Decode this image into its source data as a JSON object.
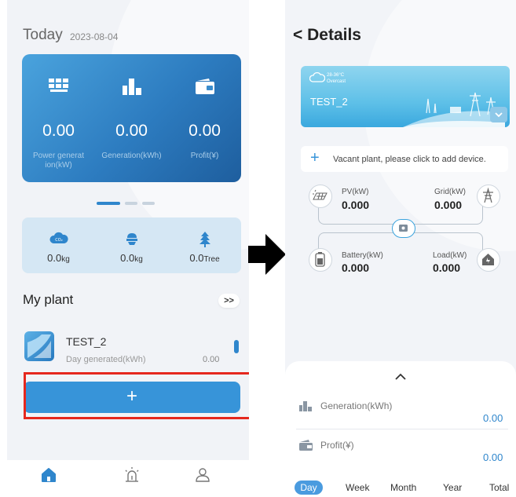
{
  "left": {
    "today_label": "Today",
    "today_date": "2023-08-04",
    "stats": [
      {
        "value": "0.00",
        "label": "Power generat ion(kW)",
        "icon": "solar-panel-icon"
      },
      {
        "value": "0.00",
        "label": "Generation(kWh)",
        "icon": "bar-chart-icon"
      },
      {
        "value": "0.00",
        "label": "Profit(¥)",
        "icon": "wallet-icon"
      }
    ],
    "eco": [
      {
        "value": "0.0",
        "unit": "kg",
        "icon": "co2-cloud-icon",
        "icon_text": "CO₂"
      },
      {
        "value": "0.0",
        "unit": "kg",
        "icon": "coal-icon"
      },
      {
        "value": "0.0",
        "unit": "Tree",
        "icon": "tree-icon"
      }
    ],
    "my_plant": "My plant",
    "more_label": ">>",
    "plant": {
      "name": "TEST_2",
      "day_label": "Day generated(kWh)",
      "day_value": "0.00"
    },
    "add_label": "+",
    "nav": [
      "home-icon",
      "alarm-icon",
      "user-icon"
    ]
  },
  "right": {
    "back_label": "<",
    "title": "Details",
    "weather": {
      "temp": "28-36°C",
      "condition": "Overcast",
      "plant_name": "TEST_2"
    },
    "vacant_plus": "+",
    "vacant_text": "Vacant plant, please click to add device.",
    "flow": {
      "pv": {
        "label": "PV(kW)",
        "value": "0.000"
      },
      "grid": {
        "label": "Grid(kW)",
        "value": "0.000"
      },
      "battery": {
        "label": "Battery(kW)",
        "value": "0.000"
      },
      "load": {
        "label": "Load(kW)",
        "value": "0.000"
      }
    },
    "sheet": {
      "caret": "^",
      "generation_label": "Generation(kWh)",
      "generation_value": "0.00",
      "profit_label": "Profit(¥)",
      "profit_value": "0.00",
      "periods": [
        "Day",
        "Week",
        "Month",
        "Year",
        "Total"
      ]
    }
  },
  "colors": {
    "accent": "#3794d9",
    "highlight_frame": "#e5281e"
  }
}
